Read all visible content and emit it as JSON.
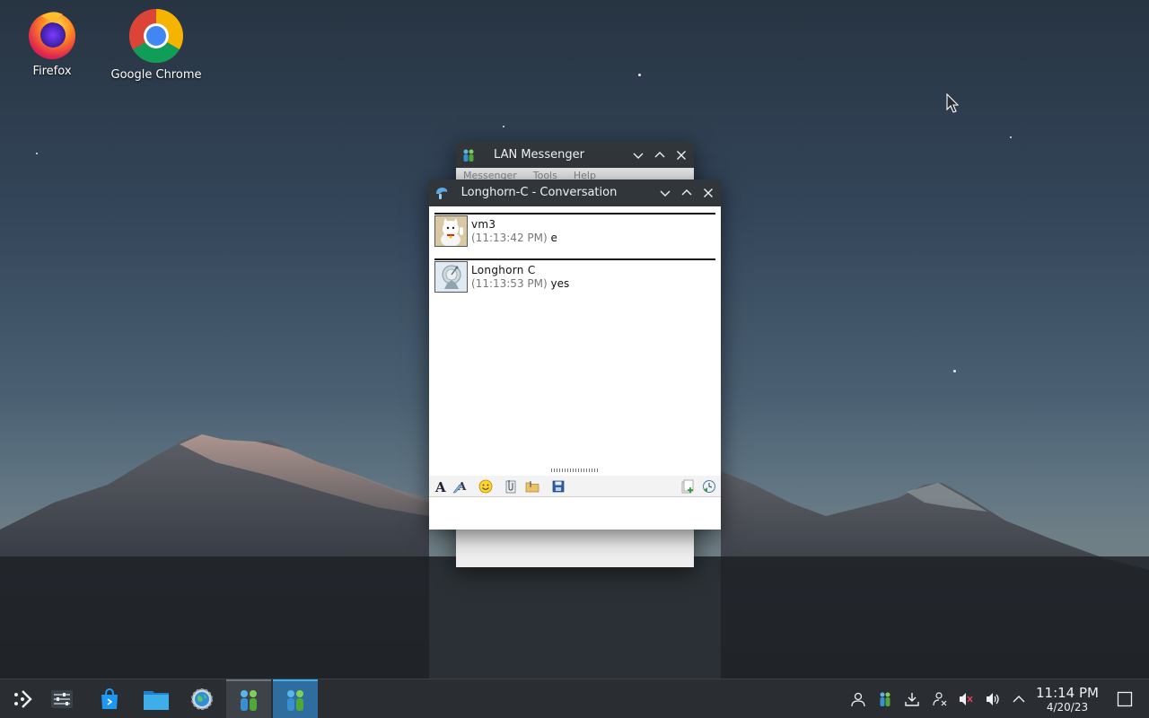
{
  "desktop": {
    "icons": [
      {
        "label": "Firefox"
      },
      {
        "label": "Google Chrome"
      }
    ]
  },
  "lan_window": {
    "title": "LAN Messenger",
    "menu": [
      "Messenger",
      "Tools",
      "Help"
    ]
  },
  "conversation": {
    "title": "Longhorn-C - Conversation",
    "messages": [
      {
        "sender": "vm3",
        "time": "(11:13:42 PM)",
        "text": "e"
      },
      {
        "sender": "Longhorn C",
        "time": "(11:13:53 PM)",
        "text": "yes"
      }
    ],
    "input_value": ""
  },
  "taskbar": {
    "time": "11:14 PM",
    "date": "4/20/23"
  },
  "colors": {
    "titlebar": "#31363b",
    "taskbar": "#2a2e32",
    "accent": "#3daee9"
  }
}
